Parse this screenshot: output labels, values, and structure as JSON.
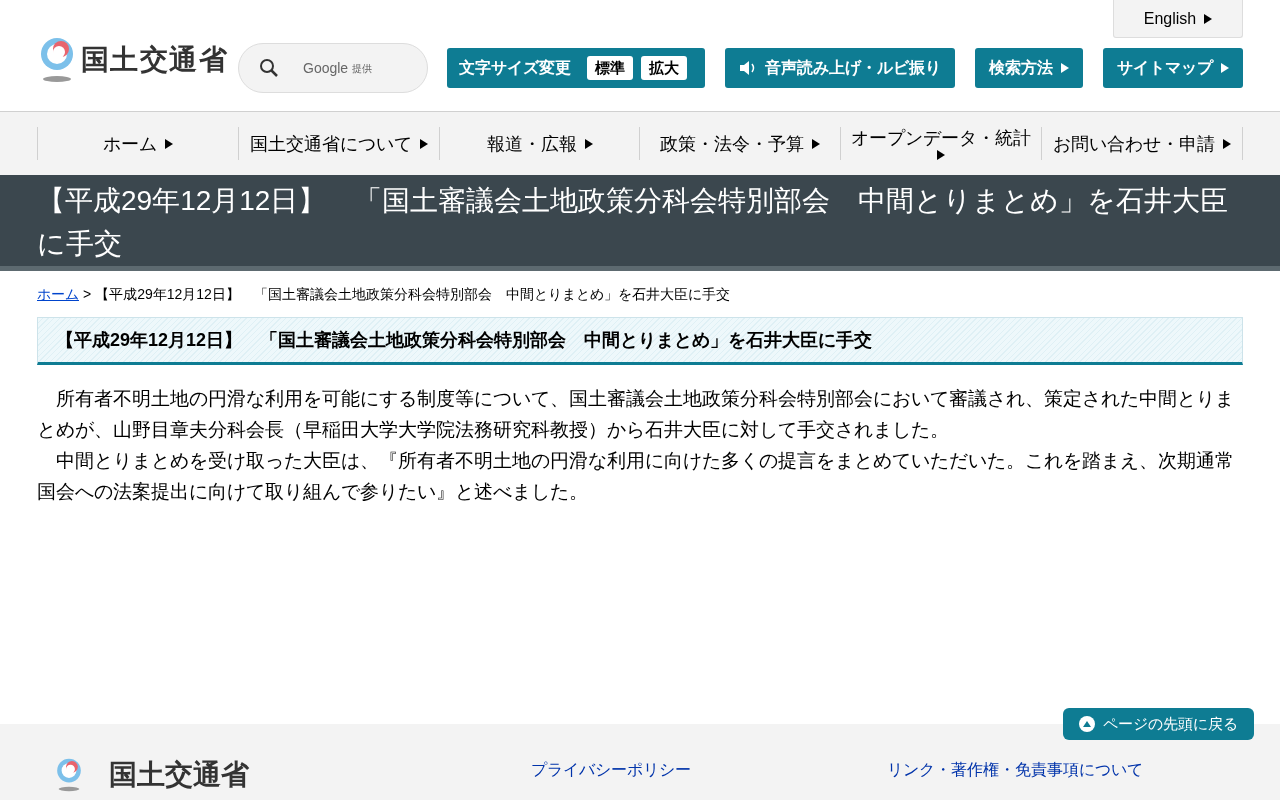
{
  "header": {
    "logo_text": "国土交通省",
    "search": {
      "provider": "Google",
      "provider_note": "提供"
    },
    "language_link": "English",
    "tools": [
      {
        "kind": "fontsize",
        "label": "文字サイズ変更",
        "options": [
          {
            "label": "標準"
          },
          {
            "label": "拡大"
          }
        ]
      },
      {
        "kind": "speech",
        "label": "音声読み上げ・ルビ振り"
      },
      {
        "kind": "link",
        "label": "検索方法"
      },
      {
        "kind": "link",
        "label": "サイトマップ"
      }
    ]
  },
  "nav": [
    {
      "label": "ホーム"
    },
    {
      "label": "国土交通省について"
    },
    {
      "label": "報道・広報"
    },
    {
      "label": "政策・法令・予算"
    },
    {
      "label": "オープンデータ・統計"
    },
    {
      "label": "お問い合わせ・申請"
    }
  ],
  "page_title": "【平成29年12月12日】　「国土審議会土地政策分科会特別部会　中間とりまとめ」を石井大臣に手交",
  "breadcrumb": {
    "home": "ホーム",
    "separator": ">",
    "current": "【平成29年12月12日】　「国土審議会土地政策分科会特別部会　中間とりまとめ」を石井大臣に手交"
  },
  "heading": "【平成29年12月12日】　「国土審議会土地政策分科会特別部会　中間とりまとめ」を石井大臣に手交",
  "paragraphs": [
    "所有者不明土地の円滑な利用を可能にする制度等について、国土審議会土地政策分科会特別部会において審議され、策定された中間とりまとめが、山野目章夫分科会長（早稲田大学大学院法務研究科教授）から石井大臣に対して手交されました。",
    "中間とりまとめを受け取った大臣は、『所有者不明土地の円滑な利用に向けた多くの提言をまとめていただいた。これを踏まえ、次期通常国会への法案提出に向けて取り組んで参りたい』と述べました。"
  ],
  "back_to_top": "ページの先頭に戻る",
  "footer": {
    "logo_text": "国土交通省",
    "links": [
      "プライバシーポリシー",
      "リンク・著作権・免責事項について"
    ]
  }
}
